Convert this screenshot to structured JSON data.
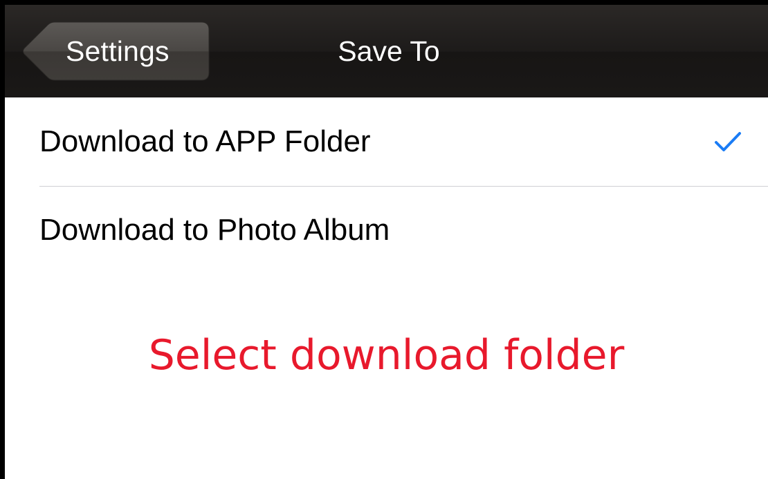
{
  "nav_bar": {
    "back_label": "Settings",
    "title": "Save To",
    "back_icon": "back-arrow-shape"
  },
  "options": [
    {
      "label": "Download to APP Folder",
      "selected": true
    },
    {
      "label": "Download to Photo Album",
      "selected": false
    }
  ],
  "annotation": {
    "text": "Select download folder",
    "color": "#e8192c"
  },
  "colors": {
    "checkmark": "#1a7cf5",
    "nav_background": "#1d1b1a",
    "nav_text": "#ffffff"
  }
}
